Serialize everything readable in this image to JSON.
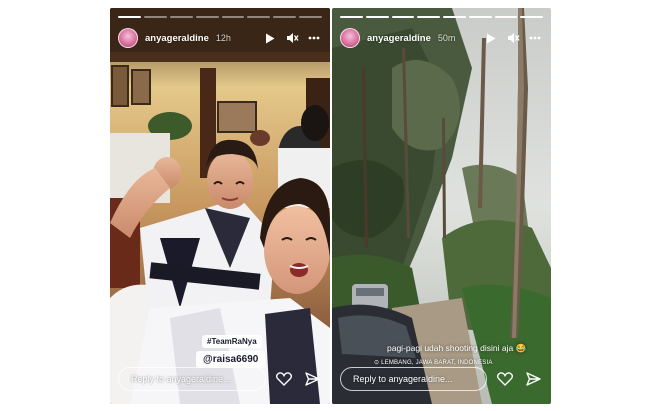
{
  "stories": [
    {
      "username": "anyageraldine",
      "time": "12h",
      "progress_segments": 8,
      "filled_segments": 1,
      "stickers": [
        "#TeamRaNya",
        "@raisa6690"
      ],
      "reply_placeholder": "Reply to anyageraldine..."
    },
    {
      "username": "anyageraldine",
      "time": "50m",
      "progress_segments": 8,
      "filled_segments": 8,
      "caption": "pagi-pagi udah shooting disini aja 😂",
      "location": "⊙ LEMBANG, JAWA BARAT, INDONESIA",
      "reply_placeholder": "Reply to anyageraldine..."
    }
  ],
  "icons": {
    "play": "play-icon",
    "mute": "mute-icon",
    "more": "more-icon",
    "like": "heart-icon",
    "share": "send-icon"
  },
  "colors": {
    "text": "#ffffff",
    "sticker_bg": "#ffffff"
  }
}
